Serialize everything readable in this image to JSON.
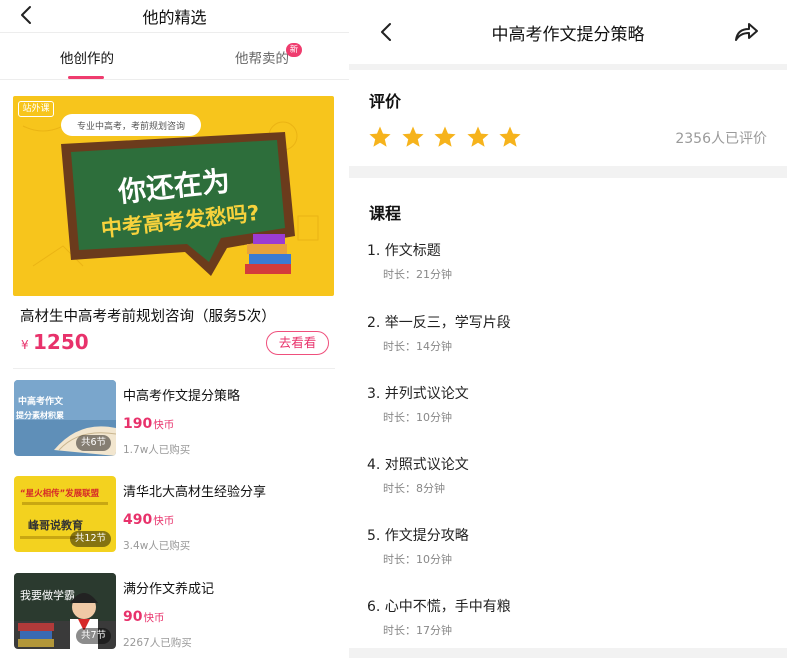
{
  "left": {
    "title": "他的精选",
    "tabs": [
      {
        "label": "他创作的",
        "active": true
      },
      {
        "label": "他帮卖的",
        "active": false
      }
    ],
    "new_badge": "新",
    "featured": {
      "tag": "站外课",
      "banner_subtitle": "专业中高考，考前规划咨询",
      "banner_line1": "你还在为",
      "banner_line2": "中考高考发愁吗?",
      "title": "高材生中高考考前规划咨询（服务5次）",
      "currency": "¥",
      "price": "1250",
      "button": "去看看"
    },
    "courses": [
      {
        "title": "中高考作文提分策略",
        "price": "190",
        "unit": "快币",
        "sold": "1.7w人已购买",
        "lessons": "共6节",
        "thumb_text_1": "中高考作文",
        "thumb_text_2": "提分素材积累"
      },
      {
        "title": "清华北大高材生经验分享",
        "price": "490",
        "unit": "快币",
        "sold": "3.4w人已购买",
        "lessons": "共12节",
        "thumb_text_1": "“星火相传”发展联盟",
        "thumb_text_2": "峰哥说教育"
      },
      {
        "title": "满分作文养成记",
        "price": "90",
        "unit": "快币",
        "sold": "2267人已购买",
        "lessons": "共7节",
        "thumb_text_1": "我要做学霸",
        "thumb_text_2": ""
      }
    ]
  },
  "right": {
    "title": "中高考作文提分策略",
    "rating": {
      "section_title": "评价",
      "stars": 5,
      "count": "2356人已评价",
      "star_color": "#f6b31c"
    },
    "course_section": {
      "title": "课程",
      "items": [
        {
          "title": "1. 作文标题",
          "duration": "时长：21分钟"
        },
        {
          "title": "2. 举一反三，学写片段",
          "duration": "时长：14分钟"
        },
        {
          "title": "3. 并列式议论文",
          "duration": "时长：10分钟"
        },
        {
          "title": "4. 对照式议论文",
          "duration": "时长：8分钟"
        },
        {
          "title": "5. 作文提分攻略",
          "duration": "时长：10分钟"
        },
        {
          "title": "6. 心中不慌，手中有粮",
          "duration": "时长：17分钟"
        }
      ]
    }
  },
  "colors": {
    "accent": "#e8326b",
    "star": "#f6b31c",
    "banner_yellow": "#f7c51c",
    "chalkboard": "#2d6e3b"
  },
  "icons": [
    "back-arrow-icon",
    "share-icon",
    "star-icon"
  ]
}
